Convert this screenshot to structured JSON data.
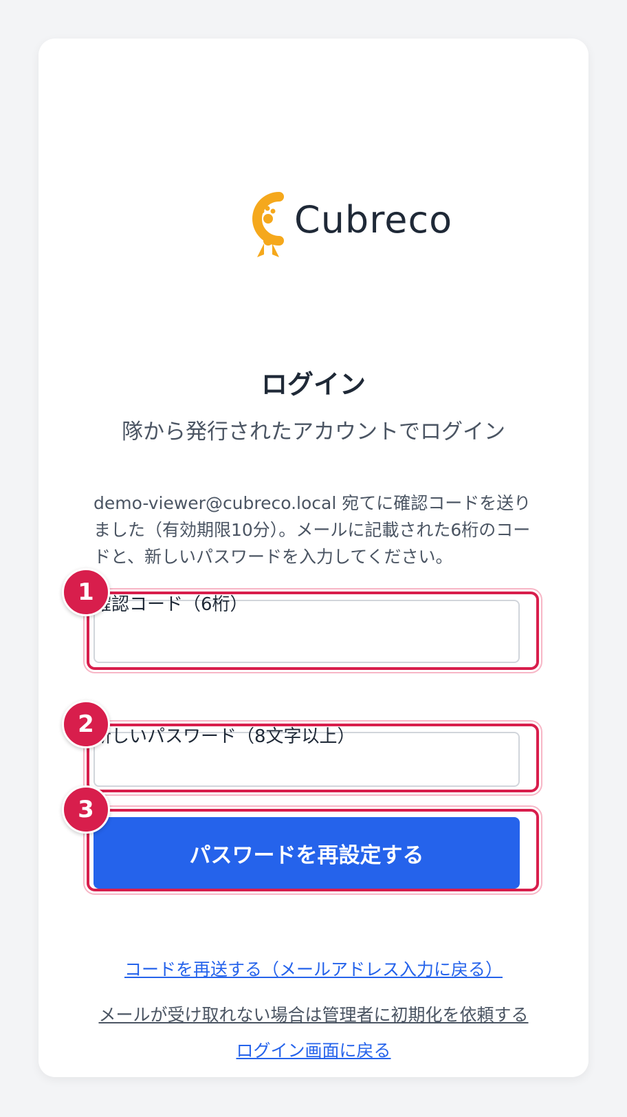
{
  "logo": {
    "name": "Cubreco",
    "mark_color": "#f5a81c"
  },
  "title": "ログイン",
  "subtitle": "隊から発行されたアカウントでログイン",
  "info_text": "demo-viewer@cubreco.local 宛てに確認コードを送りました（有効期限10分）。メールに記載された6桁のコードと、新しいパスワードを入力してください。",
  "form": {
    "code_label": "確認コード（6桁）",
    "code_value": "",
    "password_label": "新しいパスワード（8文字以上）",
    "password_value": "",
    "submit_label": "パスワードを再設定する"
  },
  "annotations": [
    "1",
    "2",
    "3"
  ],
  "links": {
    "resend": "コードを再送する（メールアドレス入力に戻る）",
    "admin_reset": "メールが受け取れない場合は管理者に初期化を依頼する",
    "back_to_login": "ログイン画面に戻る"
  },
  "colors": {
    "accent": "#2563eb",
    "annotation": "#d81e4c",
    "background": "#f3f4f6"
  }
}
